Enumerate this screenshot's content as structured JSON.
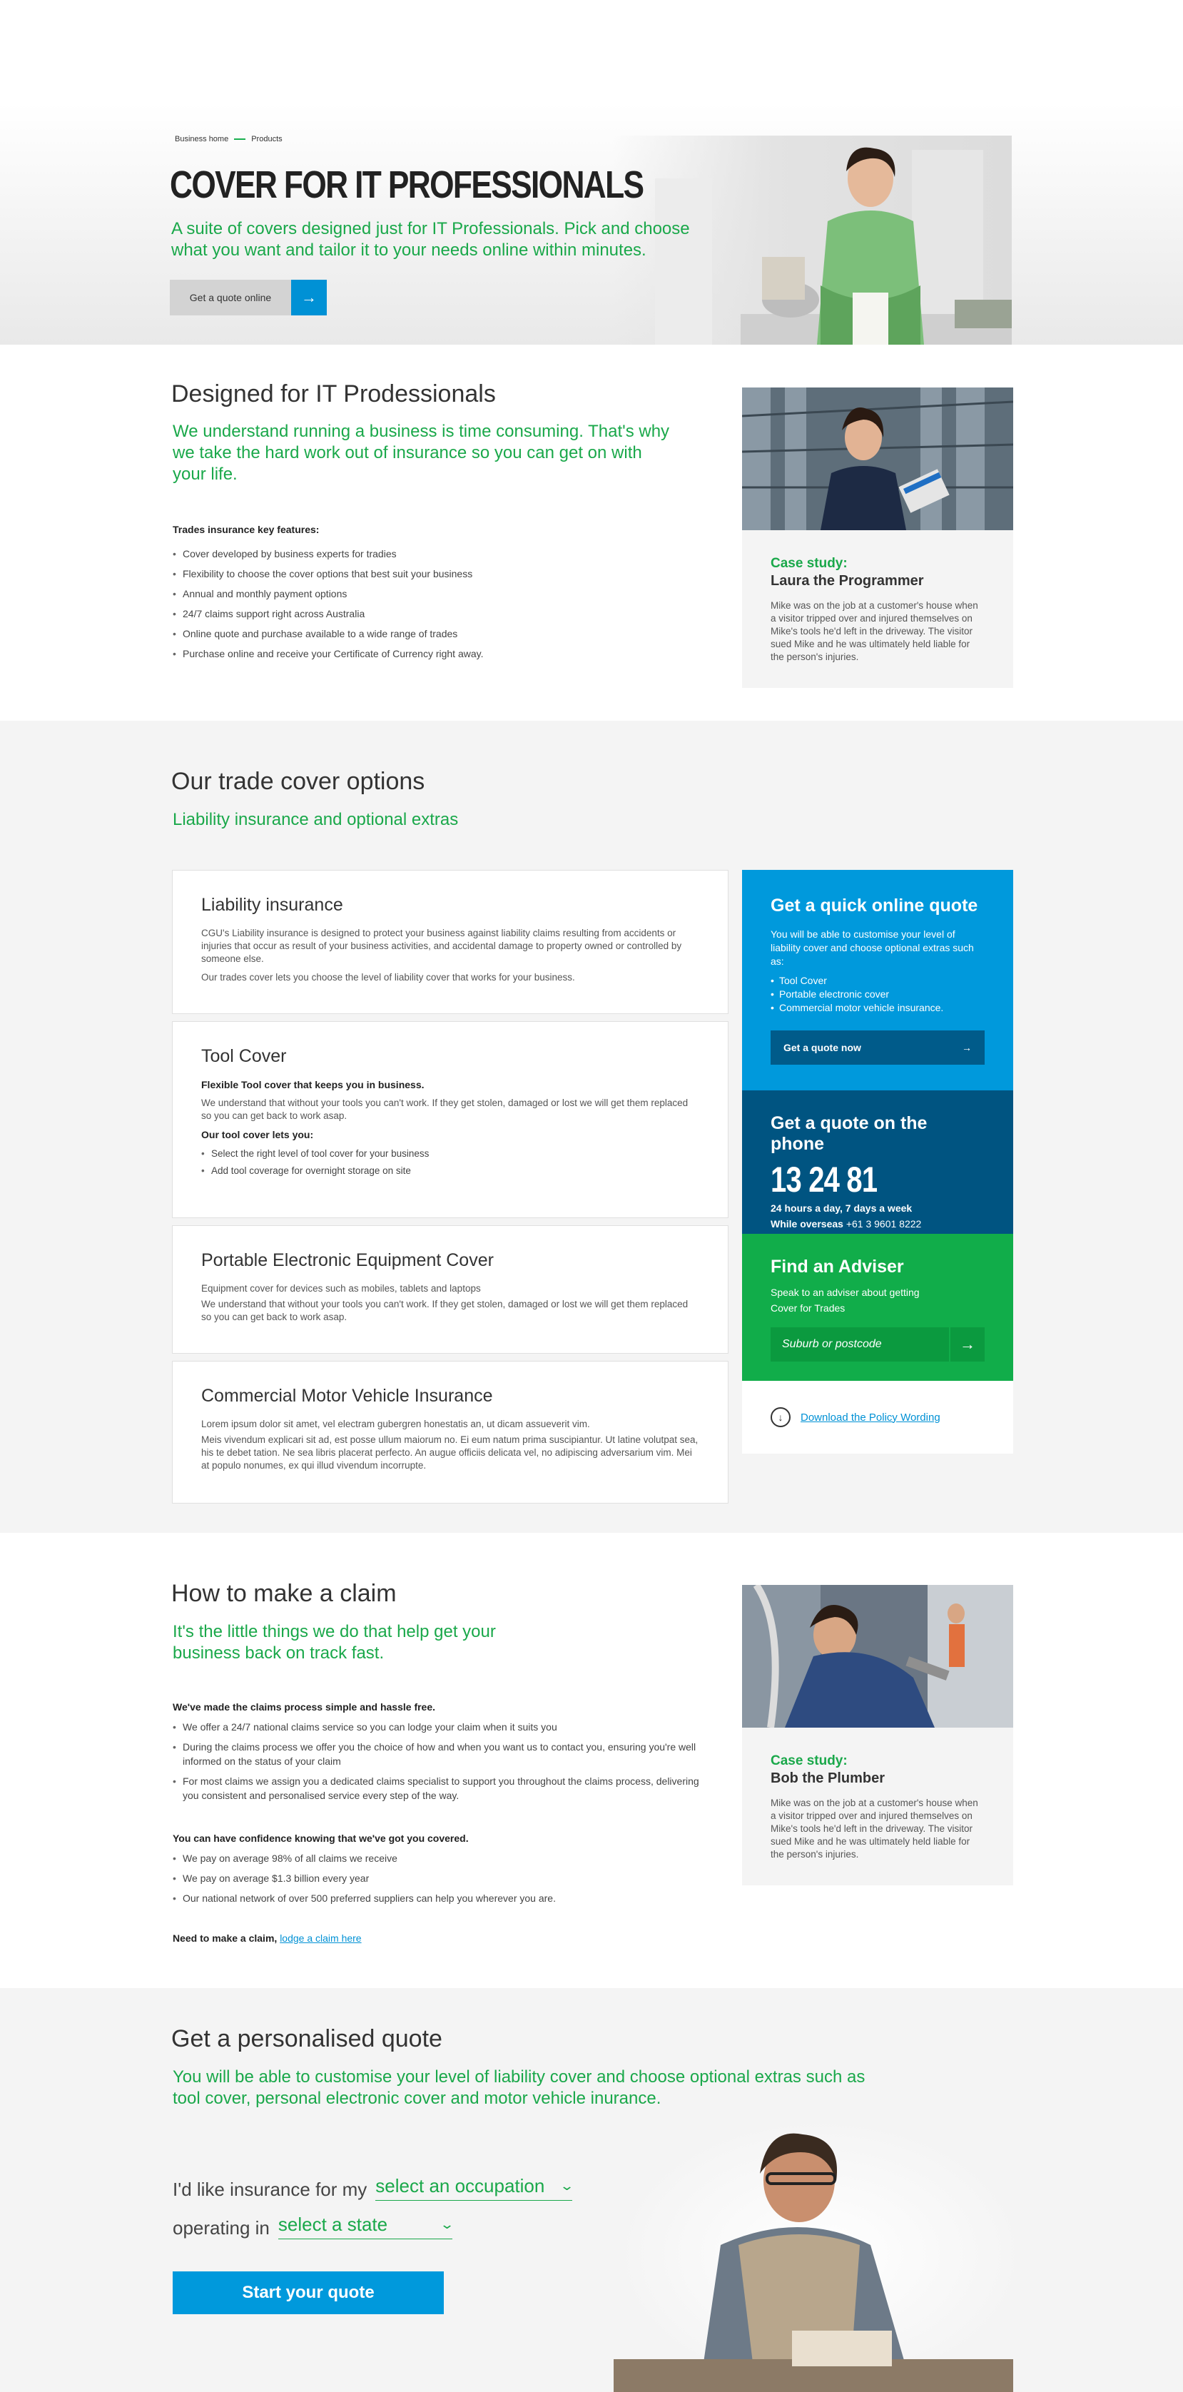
{
  "hero": {
    "breadcrumb": [
      "Business home",
      "Products"
    ],
    "title": "COVER FOR IT PROFESSIONALS",
    "subtitle": "A suite of covers designed just for IT Professionals. Pick and choose what you want and tailor it to your needs online within minutes.",
    "button_label": "Get a quote online"
  },
  "designed": {
    "title": "Designed for IT Prodessionals",
    "lead": "We understand running a business is time consuming. That's why we take the hard work out of insurance so you can get on with your life.",
    "features_title": "Trades insurance key features:",
    "features": [
      "Cover developed by business experts for tradies",
      "Flexibility to choose the cover options that best suit your business",
      "Annual and monthly payment options",
      "24/7 claims support right across Australia",
      "Online quote and purchase available to a wide range of trades",
      "Purchase online and receive your Certificate of Currency right away."
    ],
    "case": {
      "label": "Case study:",
      "name": "Laura the Programmer",
      "text": "Mike was on the job at a customer's house when a visitor tripped over and injured themselves on Mike's tools he'd left in the driveway. The visitor sued Mike and he was ultimately held liable for the person's injuries."
    }
  },
  "options": {
    "title": "Our trade cover options",
    "subtitle": "Liability insurance and optional extras",
    "cards": [
      {
        "title": "Liability insurance",
        "p1": "CGU's Liability insurance is designed to protect your business against liability claims resulting from accidents or injuries that occur as result of your business activities, and accidental damage to property owned or controlled by someone else.",
        "p2": "Our trades cover lets you choose the level of liability cover that works for your business."
      },
      {
        "title": "Tool Cover",
        "bold1": "Flexible Tool cover that keeps you in business.",
        "p1": "We understand that without your tools you can't work. If they get stolen, damaged or lost we will get them replaced so you can get back to work asap.",
        "bold2": "Our tool cover lets you:",
        "items": [
          "Select the right level of tool cover for your business",
          "Add tool coverage for overnight storage on site"
        ]
      },
      {
        "title": "Portable Electronic Equipment Cover",
        "p1": "Equipment cover for devices such as mobiles, tablets and laptops",
        "p2": "We understand that without your tools you can't work. If they get stolen, damaged or lost we will get them replaced so you can get back to work asap."
      },
      {
        "title": "Commercial Motor Vehicle Insurance",
        "p1": "Lorem ipsum dolor sit amet, vel electram gubergren honestatis an, ut dicam assueverit vim.",
        "p2": "Meis vivendum explicari sit ad, est posse ullum maiorum no. Ei eum natum prima suscipiantur. Ut latine volutpat sea, his te debet tation. Ne sea libris placerat perfecto. An augue officiis delicata vel, no adipiscing adversarium vim. Mei at populo nonumes, ex qui illud vivendum incorrupte."
      }
    ],
    "online_quote": {
      "title": "Get a quick online quote",
      "text": "You will be able to customise your level of liability cover and choose optional extras such as:",
      "items": [
        "Tool Cover",
        "Portable electronic cover",
        "Commercial motor vehicle insurance."
      ],
      "button": "Get a quote now"
    },
    "phone_quote": {
      "title": "Get a quote on the phone",
      "number": "13 24 81",
      "hours": "24 hours a day, 7 days a week",
      "overseas_label": "While overseas",
      "overseas_number": "+61 3 9601 8222"
    },
    "adviser": {
      "title": "Find an Adviser",
      "text": "Speak to an adviser about getting Cover for Trades",
      "placeholder": "Suburb or postcode"
    },
    "download": "Download the Policy Wording"
  },
  "claim": {
    "title": "How to make a claim",
    "lead": "It's the little things we do that help get your business back on track fast.",
    "list1_title": "We've made the claims process simple and hassle free.",
    "list1": [
      "We offer a 24/7 national claims service so you can lodge your claim when it suits you",
      "During the claims process we offer you the choice of how and when you want us to contact you, ensuring you're well informed on the status of your claim",
      "For most claims we assign you a dedicated claims specialist to support you throughout the claims process, delivering you consistent and personalised service every step of the way."
    ],
    "list2_title": "You can have confidence knowing that we've got you covered.",
    "list2": [
      "We pay on average 98% of all claims we receive",
      "We pay on average $1.3 billion every year",
      "Our national network of over 500 preferred suppliers can help you wherever you are."
    ],
    "need_text": "Need to make a claim,",
    "need_link": "lodge a claim here",
    "case": {
      "label": "Case study:",
      "name": "Bob the Plumber",
      "text": "Mike was on the job at a customer's house when a visitor tripped over and injured themselves on Mike's tools he'd left in the driveway. The visitor sued Mike and he was ultimately held liable for the person's injuries."
    }
  },
  "quote": {
    "title": "Get a personalised quote",
    "lead": "You will be able to customise your level of liability cover and choose optional extras such as tool cover, personal electronic cover and motor vehicle inurance.",
    "row1_label": "I'd like insurance for my",
    "row1_select": "select an occupation",
    "row2_label": "operating in",
    "row2_select": "select a state",
    "button": "Start your quote"
  },
  "colors": {
    "green": "#1aa84a",
    "blue": "#0099dc",
    "navy": "#005481",
    "adviser_green": "#11ad4a"
  }
}
